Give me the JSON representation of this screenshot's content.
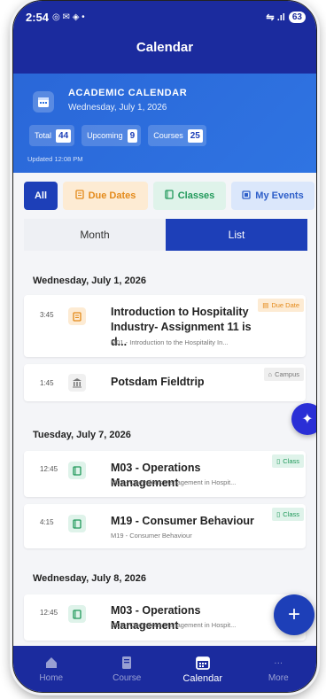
{
  "status": {
    "time": "2:54",
    "left_icons": "◎ ✉ ◈ •",
    "right_icons": "⇋ .ıl",
    "battery": "63"
  },
  "app": {
    "title": "Calendar"
  },
  "academic": {
    "title": "ACADEMIC CALENDAR",
    "date": "Wednesday, July 1, 2026",
    "stats": [
      {
        "label": "Total",
        "value": "44"
      },
      {
        "label": "Upcoming",
        "value": "9"
      },
      {
        "label": "Courses",
        "value": "25"
      }
    ],
    "updated": "Updated 12:08 PM"
  },
  "filters": {
    "all": "All",
    "due": "Due Dates",
    "classes": "Classes",
    "events": "My Events"
  },
  "view": {
    "month": "Month",
    "list": "List"
  },
  "days": [
    {
      "header": "Wednesday, July 1, 2026",
      "events": [
        {
          "time": "3:45",
          "title": "Introduction to Hospitality Industry- Assignment 11 is d...",
          "subtitle": "M01 - Introduction to the Hospitality In...",
          "badge": "Due Date",
          "type": "due",
          "icon": "document-icon"
        },
        {
          "time": "1:45",
          "title": "Potsdam Fieldtrip",
          "subtitle": "",
          "badge": "Campus",
          "type": "campus",
          "icon": "building-icon"
        }
      ]
    },
    {
      "header": "Tuesday, July 7, 2026",
      "events": [
        {
          "time": "12:45",
          "title": "M03 - Operations Management",
          "subtitle": "M03 - Operations Management in Hospit...",
          "badge": "Class",
          "type": "class",
          "icon": "book-icon"
        },
        {
          "time": "4:15",
          "title": "M19 - Consumer Behaviour",
          "subtitle": "M19 - Consumer Behaviour",
          "badge": "Class",
          "type": "class",
          "icon": "book-icon"
        }
      ]
    },
    {
      "header": "Wednesday, July 8, 2026",
      "events": [
        {
          "time": "12:45",
          "title": "M03 - Operations Management",
          "subtitle": "M03 - Operations Management in Hospit...",
          "badge": "",
          "type": "class",
          "icon": "book-icon"
        }
      ]
    }
  ],
  "nav": [
    {
      "label": "Home",
      "icon": "home-icon"
    },
    {
      "label": "Course",
      "icon": "book-icon"
    },
    {
      "label": "Calendar",
      "icon": "calendar-icon"
    },
    {
      "label": "More",
      "icon": "more-icon"
    }
  ],
  "colors": {
    "primary": "#1b2b9e",
    "accent": "#2f74e2",
    "due": "#e48a1a",
    "class": "#20995a",
    "events": "#2d5ec9"
  }
}
